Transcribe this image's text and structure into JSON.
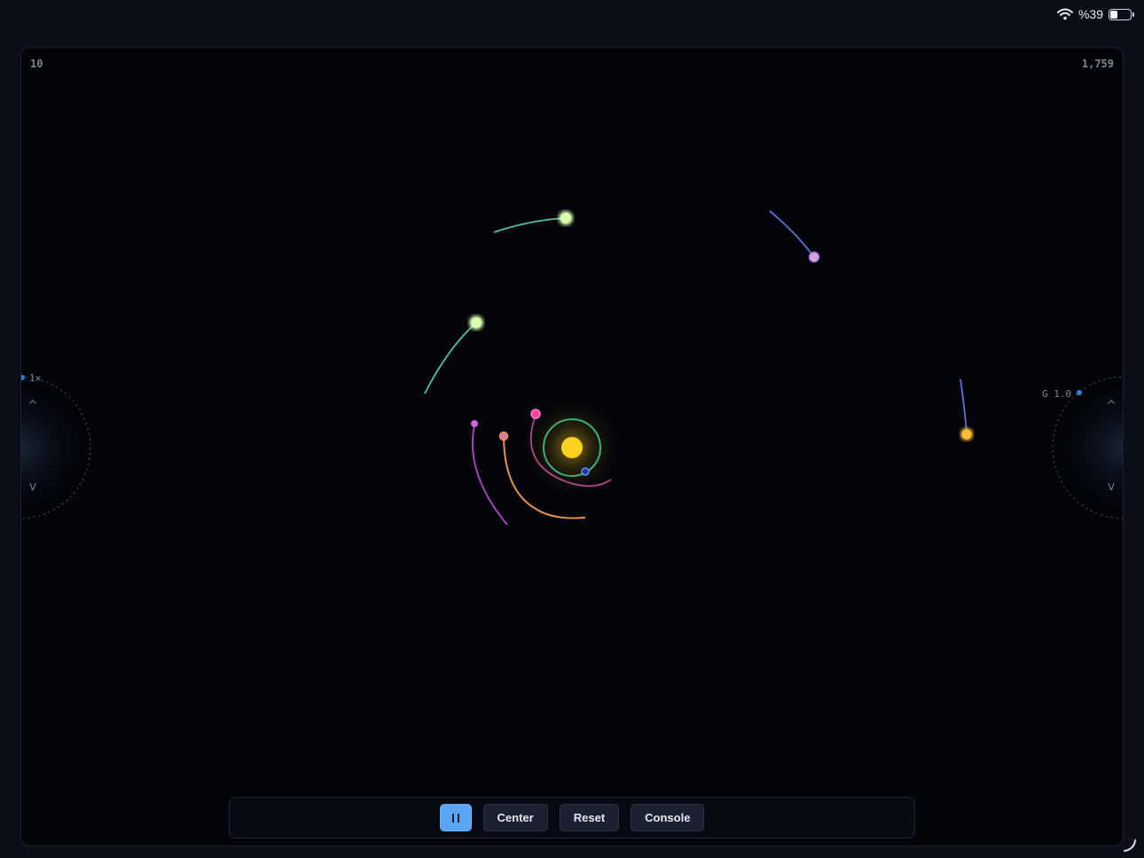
{
  "status_bar": {
    "battery_text": "%39",
    "battery_level": 0.39,
    "wifi_icon": "wifi-icon",
    "battery_icon": "battery-icon"
  },
  "canvas": {
    "top_left_text": "10",
    "top_right_text": "1,759",
    "left_dial": {
      "label": "1×",
      "up_arrow": "^",
      "down_arrow": "v",
      "up_icon": "chevron-up-icon",
      "down_icon": "chevron-down-icon"
    },
    "right_dial": {
      "label": "G 1.0",
      "up_arrow": "^",
      "down_arrow": "v",
      "up_icon": "chevron-up-icon",
      "down_icon": "chevron-down-icon"
    },
    "colors": {
      "background": "#02040a",
      "sun": "#ffd21f",
      "accent": "#5aa6f5"
    }
  },
  "toolbar": {
    "pause_icon": "pause-icon",
    "center_label": "Center",
    "reset_label": "Reset",
    "console_label": "Console"
  }
}
